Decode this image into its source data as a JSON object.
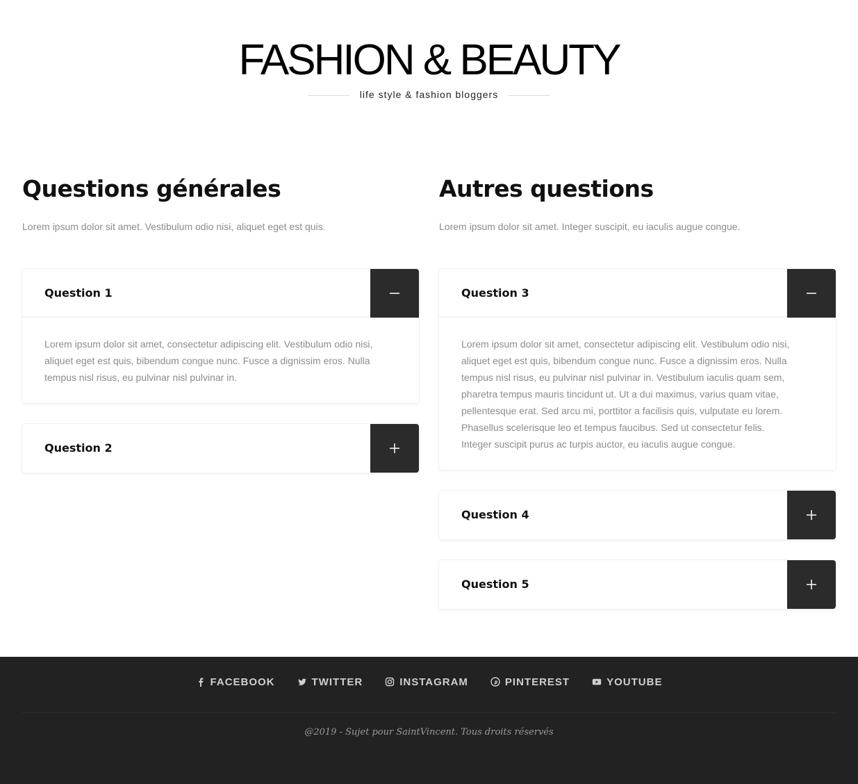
{
  "header": {
    "title": "FASHION & BEAUTY",
    "tagline": "life style & fashion bloggers"
  },
  "columns": [
    {
      "title": "Questions générales",
      "intro": "Lorem ipsum dolor sit amet. Vestibulum odio nisi, aliquet eget est quis.",
      "items": [
        {
          "question": "Question 1",
          "open": true,
          "answer": "Lorem ipsum dolor sit amet, consectetur adipiscing elit. Vestibulum odio nisi, aliquet eget est quis, bibendum congue nunc. Fusce a dignissim eros. Nulla tempus nisl risus, eu pulvinar nisl pulvinar in."
        },
        {
          "question": "Question 2",
          "open": false,
          "answer": ""
        }
      ]
    },
    {
      "title": "Autres questions",
      "intro": "Lorem ipsum dolor sit amet. Integer suscipit, eu iaculis augue congue.",
      "items": [
        {
          "question": "Question 3",
          "open": true,
          "answer": "Lorem ipsum dolor sit amet, consectetur adipiscing elit. Vestibulum odio nisi, aliquet eget est quis, bibendum congue nunc. Fusce a dignissim eros. Nulla tempus nisl risus, eu pulvinar nisl pulvinar in. Vestibulum iaculis quam sem, pharetra tempus mauris tincidunt ut. Ut a dui maximus, varius quam vitae, pellentesque erat. Sed arcu mi, porttitor a facilisis quis, vulputate eu lorem. Phasellus scelerisque leo et tempus faucibus. Sed ut consectetur felis. Integer suscipit purus ac turpis auctor, eu iaculis augue congue."
        },
        {
          "question": "Question 4",
          "open": false,
          "answer": ""
        },
        {
          "question": "Question 5",
          "open": false,
          "answer": ""
        }
      ]
    }
  ],
  "footer": {
    "social": [
      {
        "label": "FACEBOOK",
        "icon": "facebook-icon"
      },
      {
        "label": "TWITTER",
        "icon": "twitter-icon"
      },
      {
        "label": "INSTAGRAM",
        "icon": "instagram-icon"
      },
      {
        "label": "PINTEREST",
        "icon": "pinterest-icon"
      },
      {
        "label": "YOUTUBE",
        "icon": "youtube-icon"
      }
    ],
    "copyright": "@2019 - Sujet pour SaintVincent. Tous droits réservés"
  },
  "colors": {
    "toggle_bg": "#2b2b2b",
    "footer_bg": "#222222",
    "muted_text": "#8c8c8c"
  }
}
